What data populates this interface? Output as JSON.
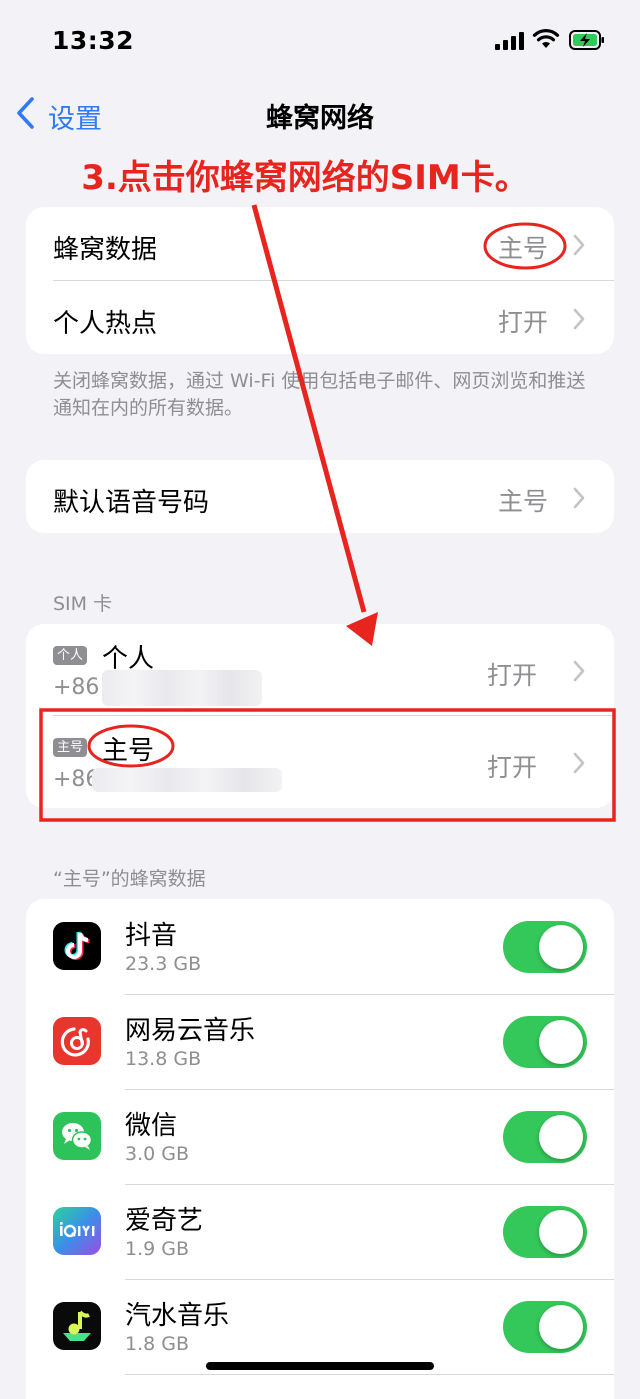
{
  "status_bar": {
    "time": "13:32"
  },
  "nav": {
    "back_label": "设置",
    "title": "蜂窝网络"
  },
  "annotation": {
    "text": "3.点击你蜂窝网络的SIM卡。",
    "color": "#e8241f"
  },
  "group1": {
    "rows": [
      {
        "label": "蜂窝数据",
        "value": "主号"
      },
      {
        "label": "个人热点",
        "value": "打开"
      }
    ],
    "footnote": "关闭蜂窝数据，通过 Wi-Fi 使用包括电子邮件、网页浏览和推送通知在内的所有数据。"
  },
  "group2": {
    "rows": [
      {
        "label": "默认语音号码",
        "value": "主号"
      }
    ]
  },
  "sim_section": {
    "header": "SIM 卡",
    "cards": [
      {
        "tag": "个人",
        "name": "个人",
        "number": "+86",
        "value": "打开"
      },
      {
        "tag": "主号",
        "name": "主号",
        "number": "+86",
        "value": "打开"
      }
    ]
  },
  "apps_section": {
    "header": "“主号”的蜂窝数据",
    "apps": [
      {
        "name": "抖音",
        "size": "23.3 GB",
        "icon": "tiktok-icon",
        "enabled": true
      },
      {
        "name": "网易云音乐",
        "size": "13.8 GB",
        "icon": "netease-music-icon",
        "enabled": true
      },
      {
        "name": "微信",
        "size": "3.0 GB",
        "icon": "wechat-icon",
        "enabled": true
      },
      {
        "name": "爱奇艺",
        "size": "1.9 GB",
        "icon": "iqiyi-icon",
        "enabled": true
      },
      {
        "name": "汽水音乐",
        "size": "1.8 GB",
        "icon": "soda-music-icon",
        "enabled": true
      }
    ]
  },
  "colors": {
    "accent": "#2f7bf6",
    "toggle_on": "#34c759",
    "annotation": "#e8241f"
  }
}
